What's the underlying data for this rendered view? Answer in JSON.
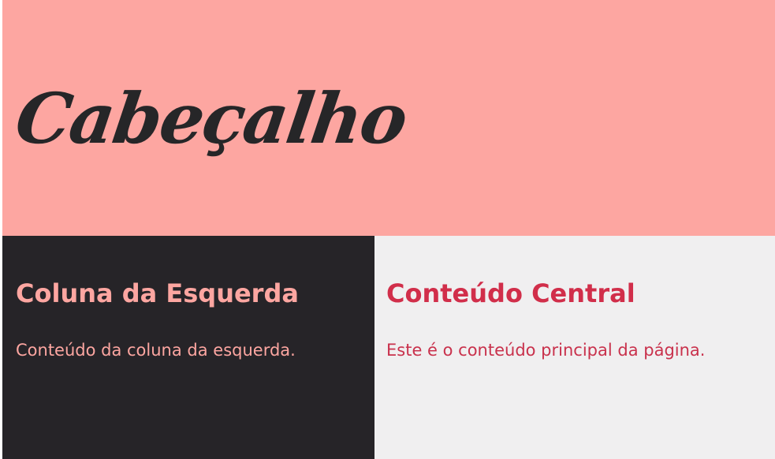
{
  "header": {
    "title": "Cabeçalho"
  },
  "left_column": {
    "heading": "Coluna da Esquerda",
    "text": "Conteúdo da coluna da esquerda."
  },
  "center_column": {
    "heading": "Conteúdo Central",
    "text": "Este é o conteúdo principal da página."
  },
  "colors": {
    "header_bg": "#fda6a1",
    "left_bg": "#262428",
    "center_bg": "#f0eff0",
    "left_text": "#fda6a1",
    "center_text": "#d12e4a"
  }
}
